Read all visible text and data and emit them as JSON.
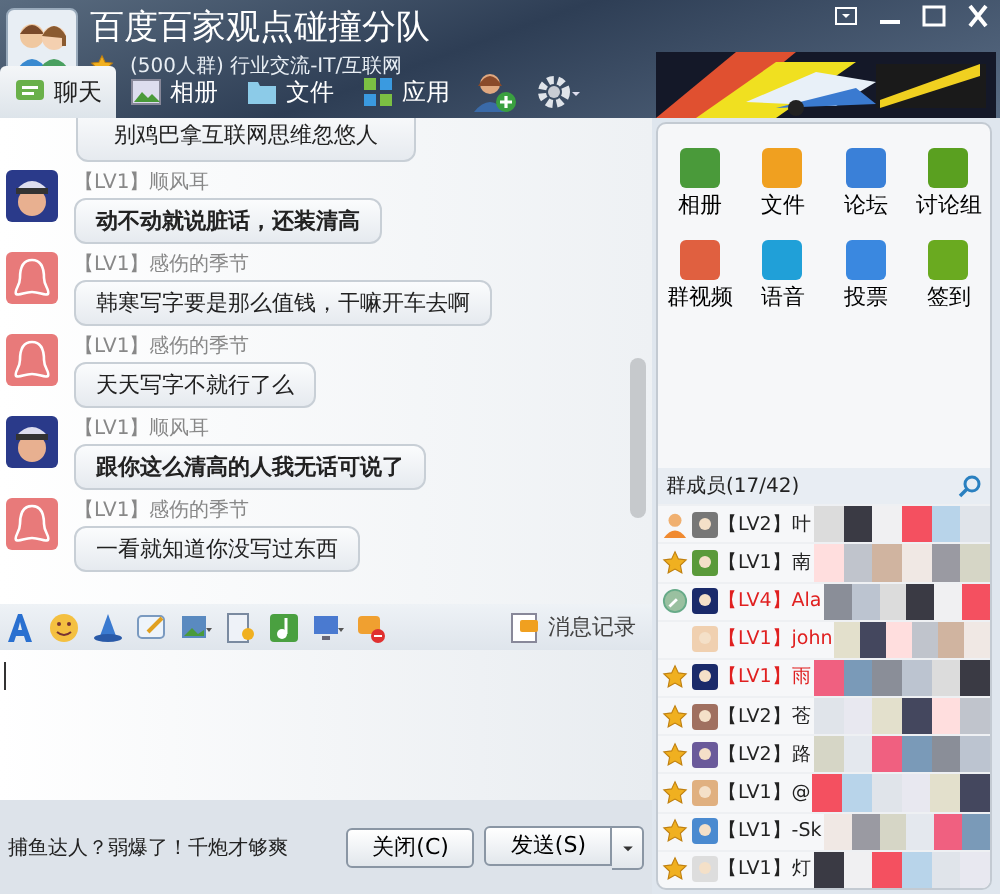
{
  "window": {
    "title": "百度百家观点碰撞分队",
    "subtitle": "(500人群) 行业交流-IT/互联网"
  },
  "tabs": [
    {
      "label": "聊天",
      "selected": true
    },
    {
      "label": "相册",
      "selected": false
    },
    {
      "label": "文件",
      "selected": false
    },
    {
      "label": "应用",
      "selected": false
    }
  ],
  "partial_message": "别鸡巴拿互联网思维忽悠人",
  "messages": [
    {
      "sender": "顺风耳",
      "level": "【LV1】",
      "kind": "robot",
      "bold": true,
      "text": "动不动就说脏话，还装清高"
    },
    {
      "sender": "感伤的季节",
      "level": "【LV1】",
      "kind": "penguin",
      "bold": false,
      "text": "韩寒写字要是那么值钱，干嘛开车去啊"
    },
    {
      "sender": "感伤的季节",
      "level": "【LV1】",
      "kind": "penguin",
      "bold": false,
      "text": "天天写字不就行了么"
    },
    {
      "sender": "顺风耳",
      "level": "【LV1】",
      "kind": "robot",
      "bold": true,
      "text": "跟你这么清高的人我无话可说了"
    },
    {
      "sender": "感伤的季节",
      "level": "【LV1】",
      "kind": "penguin",
      "bold": false,
      "text": "一看就知道你没写过东西"
    }
  ],
  "history_button": "消息记录",
  "footer": {
    "tip": "捕鱼达人？弱爆了！千炮才够爽",
    "close": "关闭(C)",
    "send": "发送(S)"
  },
  "apps": [
    {
      "label": "相册",
      "color": "#4a9a3a"
    },
    {
      "label": "文件",
      "color": "#f0a020"
    },
    {
      "label": "论坛",
      "color": "#3a80d8"
    },
    {
      "label": "讨论组",
      "color": "#5aa020"
    },
    {
      "label": "群视频",
      "color": "#e06040"
    },
    {
      "label": "语音",
      "color": "#20a0d8"
    },
    {
      "label": "投票",
      "color": "#3a88e0"
    },
    {
      "label": "签到",
      "color": "#6aaa20"
    }
  ],
  "members_header": "群成员(17/42)",
  "members": [
    {
      "kind": "owner",
      "level": "【LV2】",
      "name": "叶",
      "color": "#222222"
    },
    {
      "kind": "star",
      "level": "【LV1】",
      "name": "南",
      "color": "#222222"
    },
    {
      "kind": "admin",
      "level": "【LV4】",
      "name": "Ala",
      "color": "#e02020"
    },
    {
      "kind": "plain",
      "level": "【LV1】",
      "name": "john",
      "color": "#e02020"
    },
    {
      "kind": "star",
      "level": "【LV1】",
      "name": "雨",
      "color": "#e02020"
    },
    {
      "kind": "star",
      "level": "【LV2】",
      "name": "苍",
      "color": "#222222"
    },
    {
      "kind": "star",
      "level": "【LV2】",
      "name": "路",
      "color": "#222222"
    },
    {
      "kind": "star",
      "level": "【LV1】",
      "name": "@",
      "color": "#222222"
    },
    {
      "kind": "star",
      "level": "【LV1】",
      "name": "-Sk",
      "color": "#222222"
    },
    {
      "kind": "star",
      "level": "【LV1】",
      "name": "灯",
      "color": "#222222"
    }
  ]
}
